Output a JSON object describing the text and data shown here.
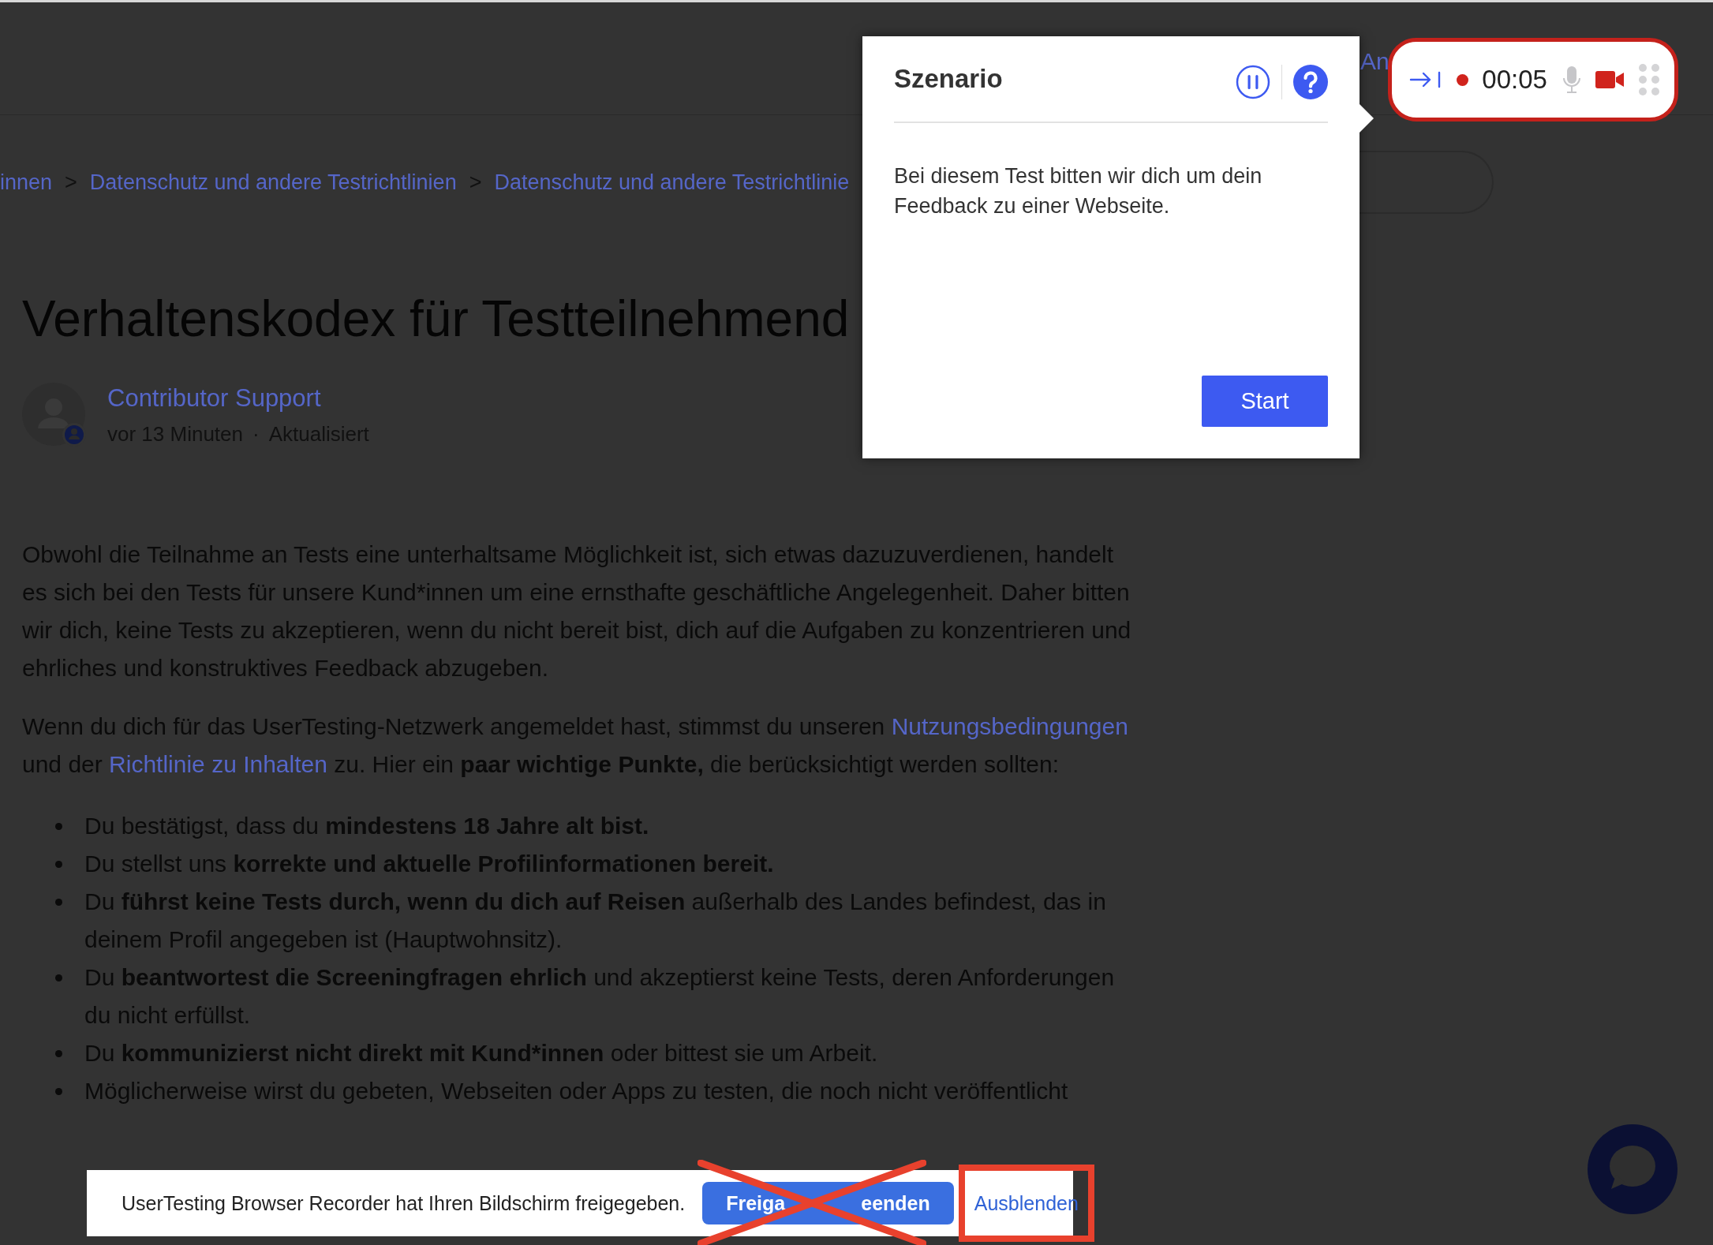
{
  "header": {
    "nav_link": "An"
  },
  "breadcrumb": {
    "separator": ">",
    "items": [
      "innen",
      "Datenschutz und andere Testrichtlinien",
      "Datenschutz und andere Testrichtlinie"
    ]
  },
  "article": {
    "title": "Verhaltenskodex für Testteilnehmend",
    "author": "Contributor Support",
    "time": "vor 13 Minuten",
    "dot": "·",
    "updated": "Aktualisiert",
    "paragraphs": [
      [
        {
          "kind": "text",
          "text": "Obwohl die Teilnahme an Tests eine unterhaltsame Möglichkeit ist, sich etwas dazuzuverdienen, handelt es sich bei den Tests für unsere Kund*innen um eine ernsthafte geschäftliche Angelegenheit. Daher bitten wir dich, keine Tests zu akzeptieren, wenn du nicht bereit bist, dich auf die Aufgaben zu konzentrieren und ehrliches und konstruktives Feedback abzugeben."
        }
      ],
      [
        {
          "kind": "text",
          "text": "Wenn du dich für das UserTesting-Netzwerk angemeldet hast, stimmst du unseren "
        },
        {
          "kind": "link",
          "text": "Nutzungsbedingungen"
        },
        {
          "kind": "text",
          "text": " und der "
        },
        {
          "kind": "link",
          "text": "Richtlinie zu Inhalten"
        },
        {
          "kind": "text",
          "text": " zu. Hier ein **paar wichtige Punkte,** die berücksichtigt werden sollten:"
        }
      ]
    ],
    "list": [
      "Du bestätigst, dass du **mindestens 18 Jahre alt bist.**",
      "Du stellst uns **korrekte und aktuelle Profilinformationen bereit.**",
      "Du **führst keine Tests durch, wenn du dich auf Reisen** außerhalb des Landes befindest, das in deinem Profil angegeben ist (Hauptwohnsitz).",
      "Du **beantwortest die Screeningfragen ehrlich** und akzeptierst keine Tests, deren Anforderungen du nicht erfüllst.",
      "Du **kommunizierst nicht direkt mit Kund*innen** oder bittest sie um Arbeit.",
      "Möglicherweise wirst du gebeten, Webseiten oder Apps zu testen, die noch nicht veröffentlicht"
    ]
  },
  "popup": {
    "title": "Szenario",
    "text": "Bei diesem Test bitten wir dich um dein Feedback zu einer Webseite.",
    "button": "Start"
  },
  "recorder": {
    "time": "00:05",
    "recording": true,
    "mic_active": false,
    "camera_active": true,
    "highlighted": true
  },
  "share_bar": {
    "message": "UserTesting Browser Recorder hat Ihren Bildschirm freigegeben.",
    "buttons": [
      {
        "label_parts": [
          "Freiga",
          "eenden"
        ],
        "kind": "primary",
        "crossed_out": true,
        "highlighted": false
      },
      {
        "label_parts": [
          "Ausblenden"
        ],
        "kind": "link",
        "crossed_out": false,
        "highlighted": true
      }
    ]
  }
}
